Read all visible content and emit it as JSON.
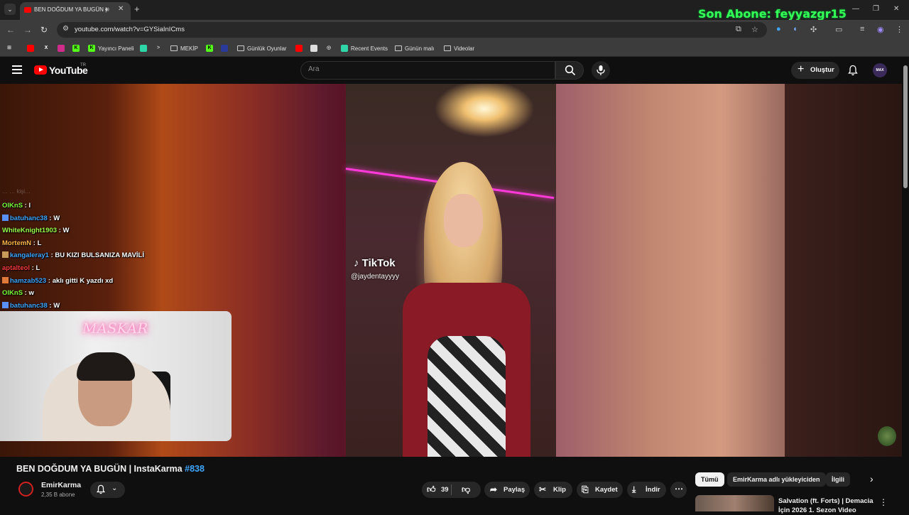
{
  "browser": {
    "tab_title": "BEN DOĞDUM YA BUGÜN | ",
    "url": "youtube.com/watch?v=GYSiaInICms",
    "bookmarks": [
      {
        "label": "Yayıncı Paneli",
        "type": "site"
      },
      {
        "label": "MEKİP",
        "type": "folder"
      },
      {
        "label": "Günlük Oyunlar",
        "type": "folder"
      },
      {
        "label": "Recent Events",
        "type": "site"
      },
      {
        "label": "Günün malı",
        "type": "folder"
      },
      {
        "label": "Videolar",
        "type": "folder"
      }
    ]
  },
  "overlay": {
    "last_subscriber": "Son Abone: feyyazgr15"
  },
  "youtube": {
    "logo": "YouTube",
    "region": "TR",
    "search_placeholder": "Ara",
    "create_label": "Oluştur",
    "avatar_text": "MAX"
  },
  "player": {
    "tiktok_brand": "TikTok",
    "tiktok_handle": "@jaydentayyyy",
    "webcam_sign": "MASKAR",
    "chat_faded": "…  …  kişi…",
    "chat": [
      {
        "user": "OlKnS",
        "message": "l",
        "color": "#7dff3a",
        "badge": ""
      },
      {
        "user": "batuhanc38",
        "message": "W",
        "color": "#3ea6ff",
        "badge": "#5a8fff"
      },
      {
        "user": "WhiteKnight1903",
        "message": "W",
        "color": "#9dff4a",
        "badge": ""
      },
      {
        "user": "MortemN",
        "message": "L",
        "color": "#ffb74a",
        "badge": ""
      },
      {
        "user": "kangaleray1",
        "message": "BU KIZI BULSANIZA MAVİLİ",
        "color": "#3ea6ff",
        "badge": "#c89a5a"
      },
      {
        "user": "aptalteol",
        "message": "L",
        "color": "#ff3a3a",
        "badge": ""
      },
      {
        "user": "hamzab523",
        "message": "aklı gitti K yazdı xd",
        "color": "#3ea6ff",
        "badge": "#e07a3a"
      },
      {
        "user": "OlKnS",
        "message": "w",
        "color": "#7dff3a",
        "badge": ""
      },
      {
        "user": "batuhanc38",
        "message": "W",
        "color": "#3ea6ff",
        "badge": "#5a8fff"
      }
    ]
  },
  "video": {
    "title": "BEN DOĞDUM YA BUGÜN | InstaKarma",
    "hashtag": "#838",
    "channel": "EmirKarma",
    "subscribers": "2,35 B abone",
    "likes": "39",
    "share_label": "Paylaş",
    "clip_label": "Klip",
    "save_label": "Kaydet",
    "download_label": "İndir"
  },
  "sidebar": {
    "chips": [
      "Tümü",
      "EmirKarma adlı yükleyiciden",
      "İlgili"
    ],
    "recommendation_title": "Salvation (ft. Forts) | Demacia İçin 2026 1. Sezon Video"
  }
}
